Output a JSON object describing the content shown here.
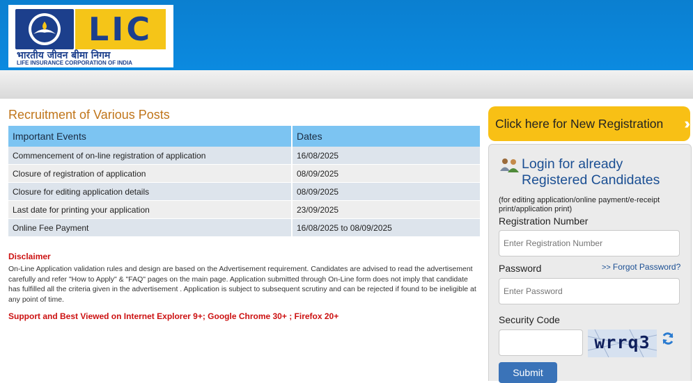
{
  "header": {
    "logo_text": "LIC",
    "logo_hindi": "भारतीय जीवन बीमा निगम",
    "logo_subtitle": "LIFE INSURANCE CORPORATION OF INDIA",
    "colors": {
      "header_blue": "#0a84d6",
      "logo_yellow": "#f5c518",
      "logo_navy": "#1c3f8c"
    }
  },
  "main": {
    "title": "Recruitment of Various Posts",
    "table": {
      "headers": [
        "Important Events",
        "Dates"
      ],
      "rows": [
        [
          "Commencement of on-line registration of application",
          "16/08/2025"
        ],
        [
          "Closure of registration of application",
          "08/09/2025"
        ],
        [
          "Closure for editing application details",
          "08/09/2025"
        ],
        [
          "Last date for printing your application",
          "23/09/2025"
        ],
        [
          "Online Fee Payment",
          "16/08/2025 to 08/09/2025"
        ]
      ]
    },
    "disclaimer_title": "Disclaimer",
    "disclaimer_text": "On-Line Application validation rules and design are based on the Advertisement requirement. Candidates are advised to read the advertisement carefully and refer \"How to Apply\" & \"FAQ\" pages on the main page. Application submitted through On-Line form does not imply that candidate has fulfilled all the criteria given in the advertisement . Application is subject to subsequent scrutiny and can be rejected if found to be ineligible at any point of time.",
    "support_text": "Support and Best Viewed on Internet Explorer 9+; Google Chrome 30+ ; Firefox 20+"
  },
  "sidebar": {
    "new_registration_label": "Click here for New Registration",
    "login_title": "Login for already Registered Candidates",
    "login_note": "(for editing application/online payment/e-receipt print/application print)",
    "registration_number_label": "Registration Number",
    "registration_number_placeholder": "Enter Registration Number",
    "password_label": "Password",
    "password_placeholder": "Enter Password",
    "forgot_password": "Forgot Password?",
    "security_code_label": "Security Code",
    "captcha_text": "wrrq3",
    "submit_label": "Submit",
    "icons": [
      "users-icon",
      "double-chevron-right-icon",
      "refresh-icon"
    ]
  }
}
